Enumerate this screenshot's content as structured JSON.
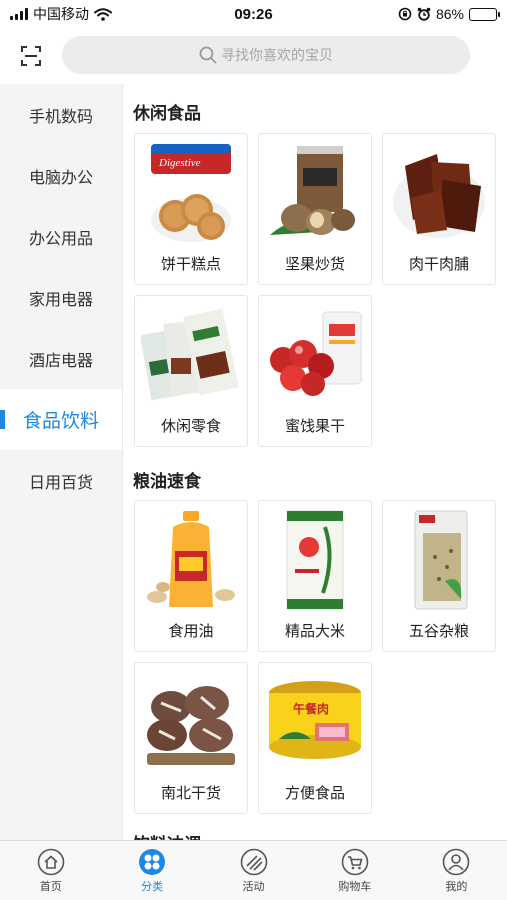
{
  "status_bar": {
    "carrier": "中国移动",
    "time": "09:26",
    "battery": "86%",
    "battery_level": 0.86
  },
  "search": {
    "placeholder": "寻找你喜欢的宝贝",
    "scan_icon": "scan-icon",
    "search_icon": "search-icon"
  },
  "sidebar": {
    "items": [
      {
        "label": "手机数码",
        "active": false
      },
      {
        "label": "电脑办公",
        "active": false
      },
      {
        "label": "办公用品",
        "active": false
      },
      {
        "label": "家用电器",
        "active": false
      },
      {
        "label": "酒店电器",
        "active": false
      },
      {
        "label": "食品饮料",
        "active": true
      },
      {
        "label": "日用百货",
        "active": false
      }
    ]
  },
  "sections": [
    {
      "title": "休闲食品",
      "items": [
        {
          "label": "饼干糕点"
        },
        {
          "label": "坚果炒货"
        },
        {
          "label": "肉干肉脯"
        },
        {
          "label": "休闲零食"
        },
        {
          "label": "蜜饯果干"
        }
      ]
    },
    {
      "title": "粮油速食",
      "items": [
        {
          "label": "食用油"
        },
        {
          "label": "精品大米"
        },
        {
          "label": "五谷杂粮"
        },
        {
          "label": "南北干货"
        },
        {
          "label": "方便食品"
        }
      ]
    },
    {
      "title": "饮料冲调"
    }
  ],
  "product_art": {
    "biscuit_brand": "Digestive",
    "luncheon_meat_label": "午餐肉"
  },
  "tabbar": {
    "items": [
      {
        "label": "首页",
        "icon": "home-icon",
        "active": false
      },
      {
        "label": "分类",
        "icon": "category-icon",
        "active": true
      },
      {
        "label": "活动",
        "icon": "activity-icon",
        "active": false
      },
      {
        "label": "购物车",
        "icon": "cart-icon",
        "active": false
      },
      {
        "label": "我的",
        "icon": "profile-icon",
        "active": false
      }
    ]
  },
  "colors": {
    "accent": "#1e88e5",
    "sidebar_bg": "#f4f4f4",
    "search_bg": "#ececec"
  }
}
